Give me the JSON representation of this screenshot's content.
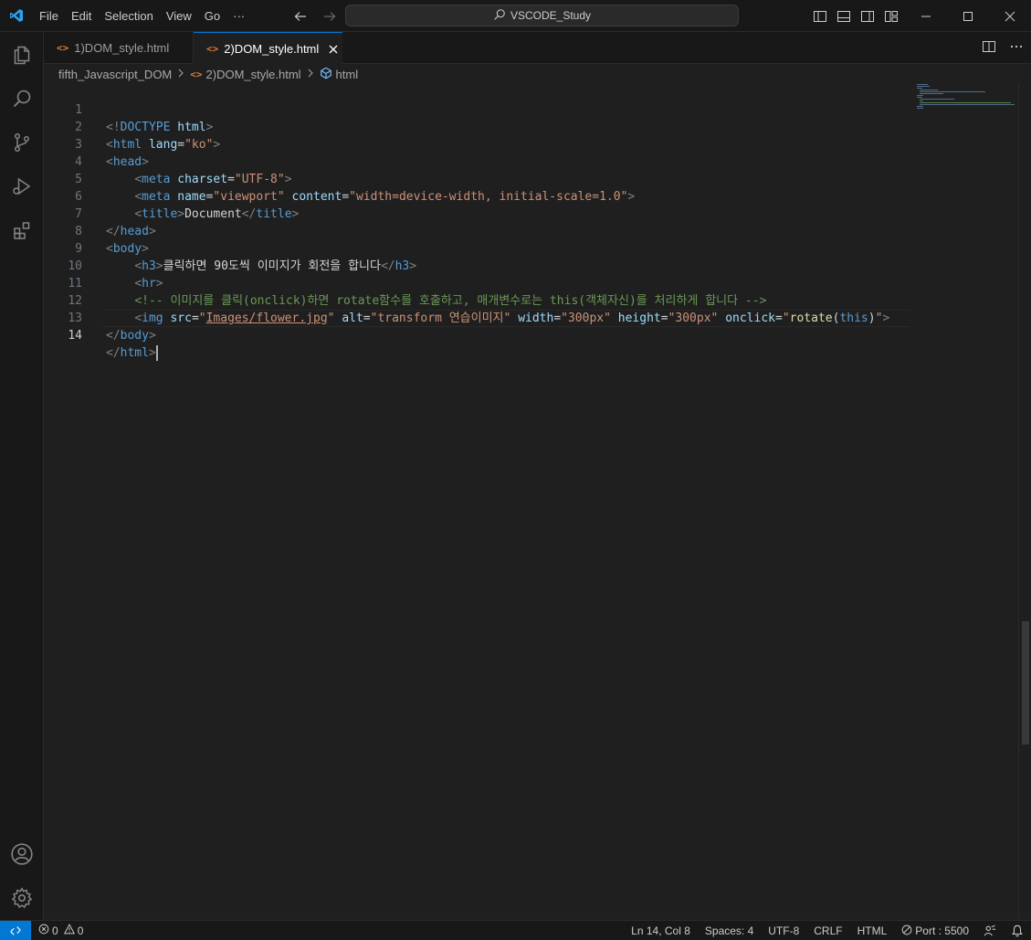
{
  "menu": [
    "File",
    "Edit",
    "Selection",
    "View",
    "Go",
    "···"
  ],
  "search": {
    "label": "VSCODE_Study"
  },
  "tabs": [
    {
      "label": "1)DOM_style.html",
      "icon": "<>"
    },
    {
      "label": "2)DOM_style.html",
      "icon": "<>"
    }
  ],
  "breadcrumb": {
    "folder": "fifth_Javascript_DOM",
    "file": "2)DOM_style.html",
    "icon": "<>",
    "symbol": "html"
  },
  "editor": {
    "line_numbers": [
      "1",
      "2",
      "3",
      "4",
      "5",
      "6",
      "7",
      "8",
      "9",
      "10",
      "11",
      "12",
      "13",
      "14"
    ],
    "active_line": 14,
    "tokens": {
      "l1_open": "<!",
      "l1_doctype": "DOCTYPE",
      "l1_html": "html",
      "l1_close": ">",
      "l2_tag": "html",
      "l2_attr": "lang",
      "l2_val": "\"ko\"",
      "l3_tag": "head",
      "l4_tag": "meta",
      "l4_attr": "charset",
      "l4_val": "\"UTF-8\"",
      "l5_tag": "meta",
      "l5_attr1": "name",
      "l5_val1": "\"viewport\"",
      "l5_attr2": "content",
      "l5_val2": "\"width=device-width, initial-scale=1.0\"",
      "l6_tag": "title",
      "l6_text": "Document",
      "l6_endtag": "title",
      "l7_tag": "head",
      "l8_tag": "body",
      "l9_tag": "h3",
      "l9_text": "클릭하면 90도씩 이미지가 회전을 합니다",
      "l9_endtag": "h3",
      "l10_tag": "hr",
      "l11_comment": "<!-- 이미지를 클릭(onclick)하면 rotate함수를 호출하고, 매개변수로는 this(객체자신)를 처리하게 합니다 -->",
      "l12_tag": "img",
      "l12_attr1": "src",
      "l12_val1": "Images/flower.jpg",
      "l12_attr2": "alt",
      "l12_val2": "\"transform 연습이미지\"",
      "l12_attr3": "width",
      "l12_val3": "\"300px\"",
      "l12_attr4": "height",
      "l12_val4": "\"300px\"",
      "l12_attr5": "onclick",
      "l12_fn": "rotate",
      "l12_arg": "this",
      "l13_tag": "body",
      "l14_tag": "html"
    }
  },
  "statusbar": {
    "errors": "0",
    "warnings": "0",
    "position": "Ln 14, Col 8",
    "spaces": "Spaces: 4",
    "encoding": "UTF-8",
    "eol": "CRLF",
    "language": "HTML",
    "port": "Port : 5500"
  },
  "colors": {
    "accent": "#0078d4",
    "background": "#1f1f1f",
    "chrome": "#181818"
  }
}
